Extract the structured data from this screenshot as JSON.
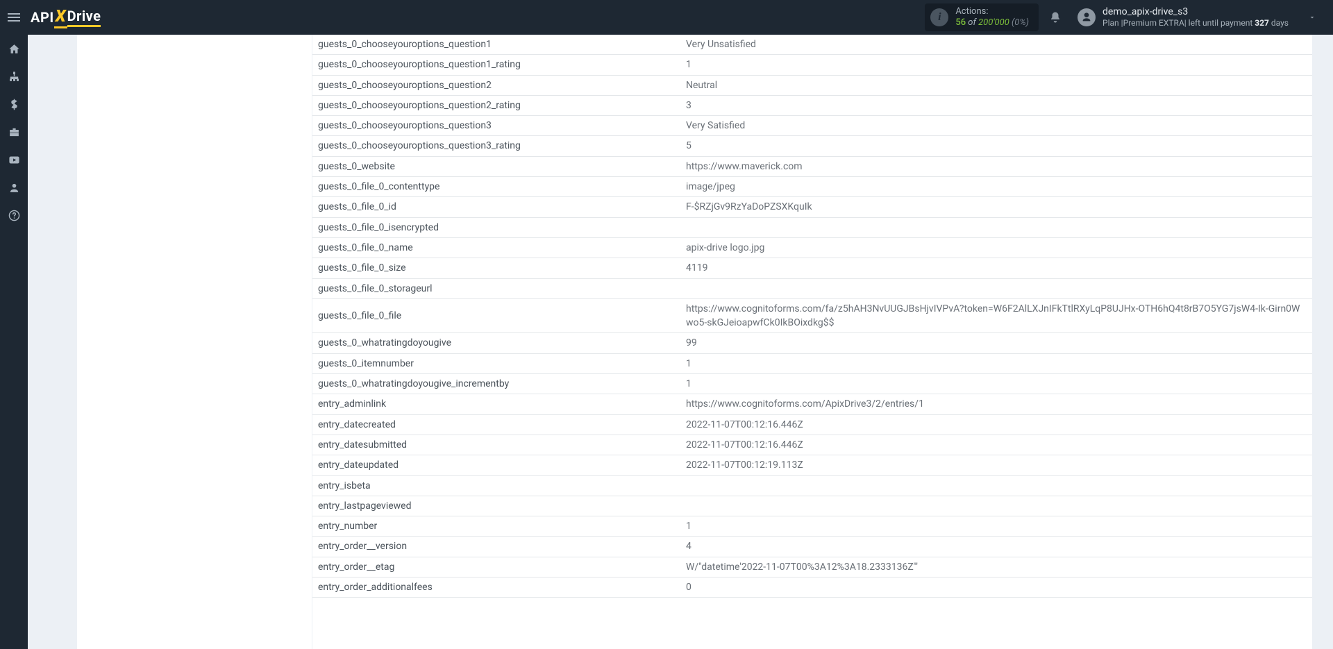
{
  "header": {
    "logo": {
      "part1": "API",
      "x": "X",
      "part2": "Drive"
    },
    "actions": {
      "label": "Actions:",
      "count": "56",
      "of": " of ",
      "total": "200'000",
      "pct": " (0%)"
    },
    "user": {
      "name": "demo_apix-drive_s3",
      "plan_prefix": "Plan |",
      "plan_name": "Premium EXTRA",
      "plan_suffix": "| left until payment ",
      "days_num": "327",
      "days_word": " days"
    }
  },
  "sidebar_icons": [
    "home-icon",
    "sitemap-icon",
    "dollar-icon",
    "briefcase-icon",
    "youtube-icon",
    "user-icon",
    "help-icon"
  ],
  "rows": [
    {
      "k": "guests_0_chooseyouroptions_question1",
      "v": "Very Unsatisfied"
    },
    {
      "k": "guests_0_chooseyouroptions_question1_rating",
      "v": "1"
    },
    {
      "k": "guests_0_chooseyouroptions_question2",
      "v": "Neutral"
    },
    {
      "k": "guests_0_chooseyouroptions_question2_rating",
      "v": "3"
    },
    {
      "k": "guests_0_chooseyouroptions_question3",
      "v": "Very Satisfied"
    },
    {
      "k": "guests_0_chooseyouroptions_question3_rating",
      "v": "5"
    },
    {
      "k": "guests_0_website",
      "v": "https://www.maverick.com"
    },
    {
      "k": "guests_0_file_0_contenttype",
      "v": "image/jpeg"
    },
    {
      "k": "guests_0_file_0_id",
      "v": "F-$RZjGv9RzYaDoPZSXKquIk"
    },
    {
      "k": "guests_0_file_0_isencrypted",
      "v": ""
    },
    {
      "k": "guests_0_file_0_name",
      "v": "apix-drive logo.jpg"
    },
    {
      "k": "guests_0_file_0_size",
      "v": "4119"
    },
    {
      "k": "guests_0_file_0_storageurl",
      "v": ""
    },
    {
      "k": "guests_0_file_0_file",
      "v": "https://www.cognitoforms.com/fa/z5hAH3NvUUGJBsHjvIVPvA?token=W6F2AlLXJnIFkTtlRXyLqP8UJHx-OTH6hQ4t8rB7O5YG7jsW4-Ik-Girn0Wwo5-skGJeioapwfCk0IkBOixdkg$$"
    },
    {
      "k": "guests_0_whatratingdoyougive",
      "v": "99"
    },
    {
      "k": "guests_0_itemnumber",
      "v": "1"
    },
    {
      "k": "guests_0_whatratingdoyougive_incrementby",
      "v": "1"
    },
    {
      "k": "entry_adminlink",
      "v": "https://www.cognitoforms.com/ApixDrive3/2/entries/1"
    },
    {
      "k": "entry_datecreated",
      "v": "2022-11-07T00:12:16.446Z"
    },
    {
      "k": "entry_datesubmitted",
      "v": "2022-11-07T00:12:16.446Z"
    },
    {
      "k": "entry_dateupdated",
      "v": "2022-11-07T00:12:19.113Z"
    },
    {
      "k": "entry_isbeta",
      "v": ""
    },
    {
      "k": "entry_lastpageviewed",
      "v": ""
    },
    {
      "k": "entry_number",
      "v": "1"
    },
    {
      "k": "entry_order__version",
      "v": "4"
    },
    {
      "k": "entry_order__etag",
      "v": "W/\"datetime'2022-11-07T00%3A12%3A18.2333136Z'\""
    },
    {
      "k": "entry_order_additionalfees",
      "v": "0"
    }
  ]
}
